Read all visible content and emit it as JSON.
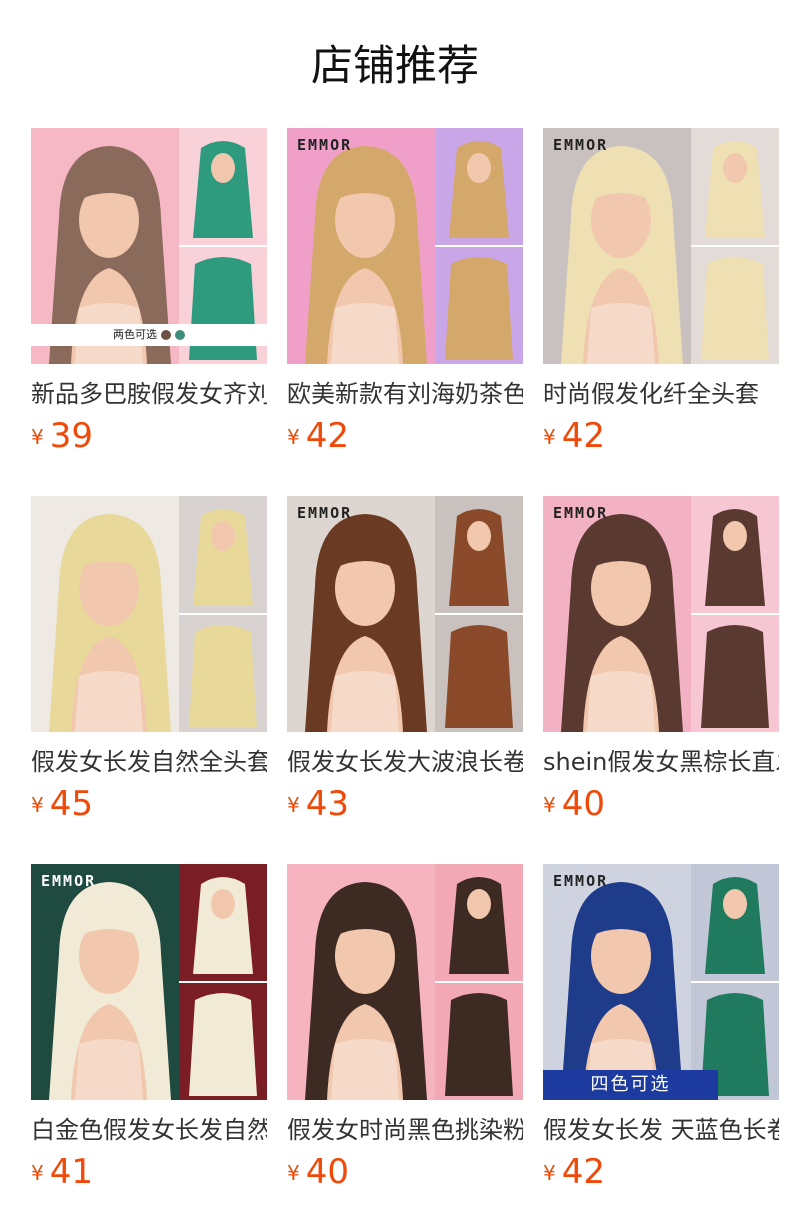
{
  "section_title": "店铺推荐",
  "currency": "¥",
  "colors": {
    "price": "#f04a0a",
    "badge_blue": "#1d3a9e"
  },
  "products": [
    {
      "name": "新品多巴胺假发女齐刘海",
      "price": "39",
      "brand": "",
      "badge": "两色可选",
      "bg": [
        "#f5b8c4",
        "#f8d1d9"
      ],
      "hair": "#8a6a5a",
      "hair2": "#2e9a7e"
    },
    {
      "name": "欧美新款有刘海奶茶色",
      "price": "42",
      "brand": "EMMOR",
      "badge": "",
      "bg": [
        "#f0a0c8",
        "#c9a6e8"
      ],
      "hair": "#d4a86a",
      "hair2": "#d4a86a"
    },
    {
      "name": "时尚假发化纤全头套",
      "price": "42",
      "brand": "EMMOR",
      "badge": "",
      "bg": [
        "#c9c1c0",
        "#e2dbd8"
      ],
      "hair": "#efe0b4",
      "hair2": "#efe0b4"
    },
    {
      "name": "假发女长发自然全头套",
      "price": "45",
      "brand": "",
      "badge": "",
      "bg": [
        "#efe9e4",
        "#d8d3d0"
      ],
      "hair": "#e8d89a",
      "hair2": "#e8d89a"
    },
    {
      "name": "假发女长发大波浪长卷发",
      "price": "43",
      "brand": "EMMOR",
      "badge": "",
      "bg": [
        "#ddd6d0",
        "#c8c1bd"
      ],
      "hair": "#6b3a22",
      "hair2": "#8a4a2a"
    },
    {
      "name": "shein假发女黑棕长直发",
      "price": "40",
      "brand": "EMMOR",
      "badge": "",
      "bg": [
        "#f3b2c4",
        "#f6c6d2"
      ],
      "hair": "#5a3a30",
      "hair2": "#5a3a30"
    },
    {
      "name": "白金色假发女长发自然",
      "price": "41",
      "brand": "EMMOR",
      "badge": "",
      "bg": [
        "#1f4a3f",
        "#7a1d24"
      ],
      "hair": "#f1ead6",
      "hair2": "#f1ead6"
    },
    {
      "name": "假发女时尚黑色挑染粉色",
      "price": "40",
      "brand": "",
      "badge": "",
      "bg": [
        "#f5b4c0",
        "#f3a8b6"
      ],
      "hair": "#3d2a22",
      "hair2": "#3d2a22"
    },
    {
      "name": "假发女长发 天蓝色长卷发",
      "price": "42",
      "brand": "EMMOR",
      "badge": "四色可选",
      "bg": [
        "#cfd3e0",
        "#c1c7d6"
      ],
      "hair": "#1e3c8a",
      "hair2": "#1f7a5e"
    }
  ]
}
